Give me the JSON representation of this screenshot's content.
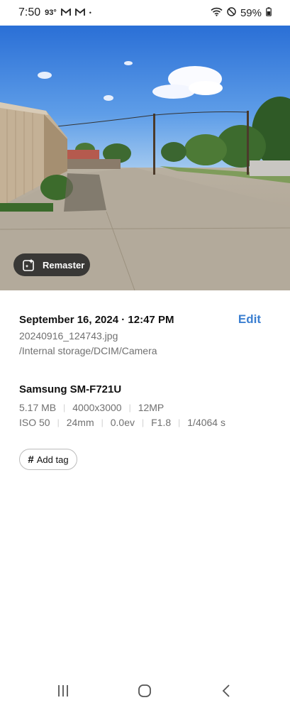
{
  "status_bar": {
    "time": "7:50",
    "temperature": "93°",
    "notification_icons": [
      "gmail-icon",
      "gmail-icon"
    ],
    "dot": "•",
    "battery_percent": "59%",
    "battery_icon": "🔋"
  },
  "photo": {
    "remaster_label": "Remaster"
  },
  "details": {
    "date": "September 16, 2024 · 12:47 PM",
    "edit_label": "Edit",
    "filename": "20240916_124743.jpg",
    "path": "/Internal storage/DCIM/Camera",
    "device": "Samsung SM-F721U",
    "size": "5.17 MB",
    "resolution": "4000x3000",
    "megapixels": "12MP",
    "iso": "ISO 50",
    "focal_length": "24mm",
    "exposure_value": "0.0ev",
    "aperture": "F1.8",
    "shutter": "1/4064 s",
    "add_tag_label": "Add tag",
    "separator": "|"
  },
  "colors": {
    "accent": "#3b7fd1",
    "secondary_text": "#707070",
    "chip_border": "#bcbcbc"
  }
}
